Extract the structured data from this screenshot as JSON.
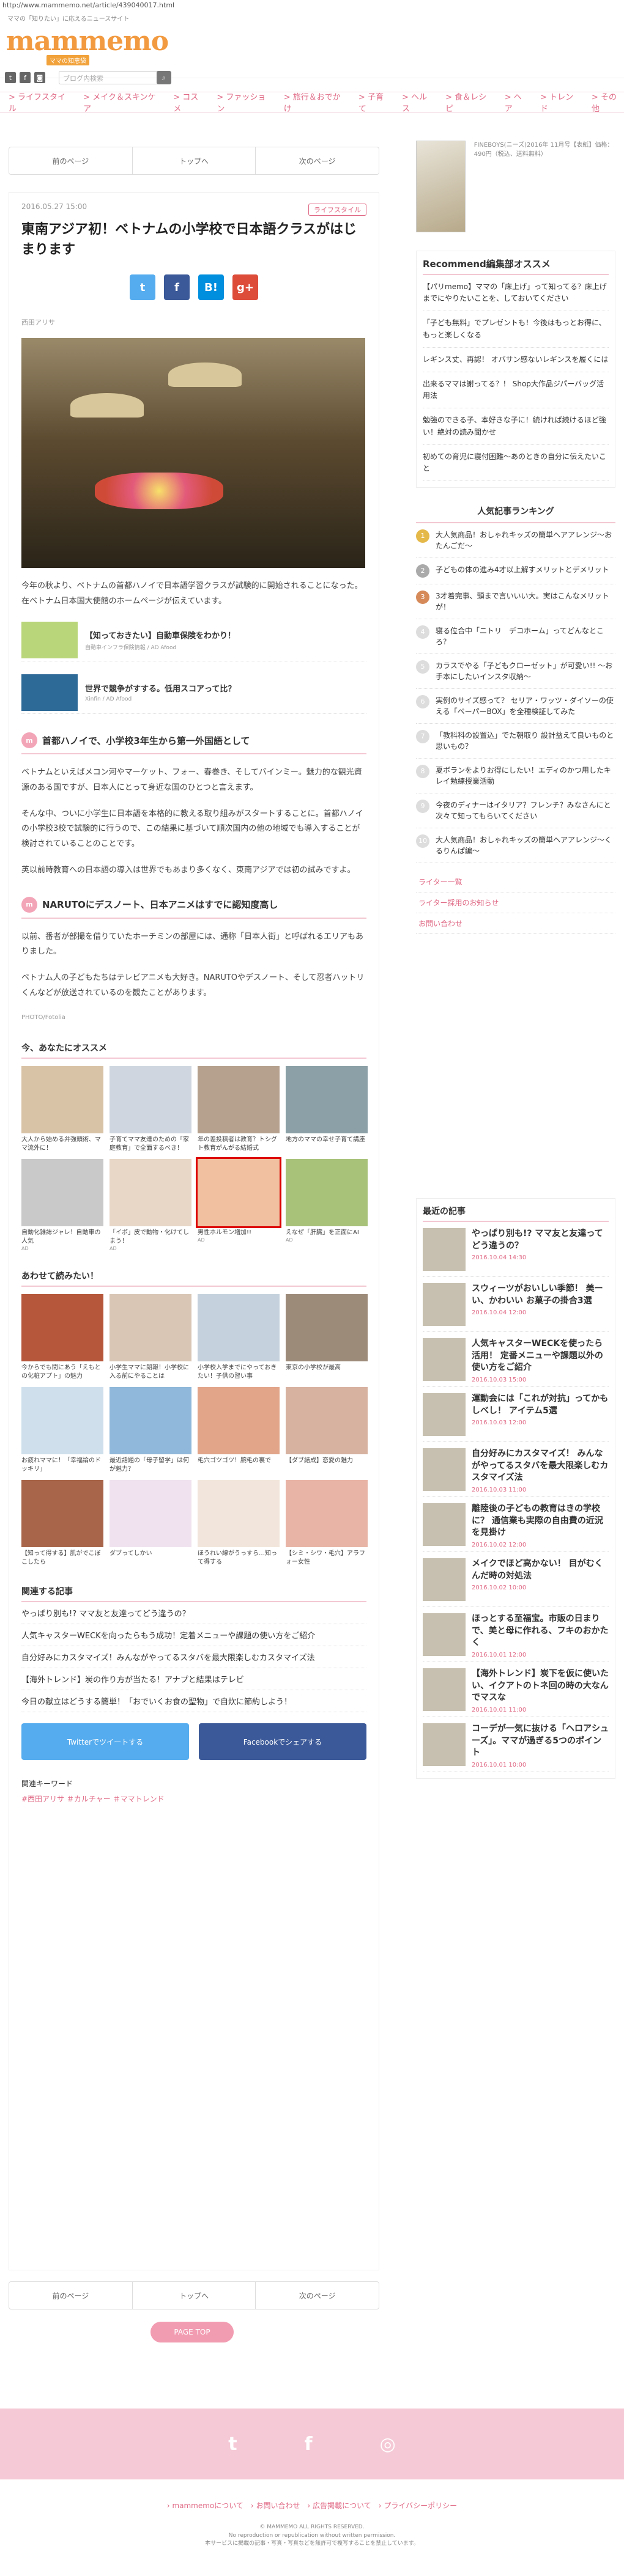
{
  "url": "http://www.mammemo.net/article/439040017.html",
  "header": {
    "tagline": "ママの「知りたい」に応えるニュースサイト",
    "logo": "mammemo",
    "logo_sub": "ママの知恵袋",
    "search_placeholder": "ブログ内検索"
  },
  "gnav": [
    "ライフスタイル",
    "メイク＆スキンケア",
    "コスメ",
    "ファッション",
    "旅行＆おでかけ",
    "子育て",
    "ヘルス",
    "食＆レシピ",
    "ヘア",
    "トレンド",
    "その他"
  ],
  "pager": [
    "前のページ",
    "トップへ",
    "次のページ"
  ],
  "article": {
    "date": "2016.05.27 15:00",
    "category": "ライフスタイル",
    "title": "東南アジア初！ベトナムの小学校で日本語クラスがはじまります",
    "author": "西田アリサ",
    "p1": "今年の秋より、ベトナムの首都ハノイで日本語学習クラスが試験的に開始されることになった。在ベトナム日本国大使館のホームページが伝えています。",
    "ads": [
      {
        "title": "【知っておきたい】自動車保険をわかり！",
        "src": "自動車インフラ保険情報 / AD Afood"
      },
      {
        "title": "世界で競争がすする。低用スコアって比？",
        "src": "Xinfin / AD Afood"
      }
    ],
    "h2_1": "首都ハノイで、小学校3年生から第一外国語として",
    "p2": "ベトナムといえばメコン河やマーケット、フォー、春巻き、そしてバインミー。魅力的な観光資源のある国ですが、日本人にとって身近な国のひとつと言えます。",
    "p3": "そんな中、ついに小学生に日本語を本格的に教える取り組みがスタートすることに。首都ハノイの小学校3校で試験的に行うので、この結果に基づいて順次国内の他の地域でも導入することが検討されていることのことです。",
    "p4": "英以前時教育への日本語の導入は世界でもあまり多くなく、東南アジアでは初の試みですよ。",
    "h2_2": "NARUTOにデスノート、日本アニメはすでに認知度高し",
    "p5": "以前、番者が部撮を借りていたホーチミンの部屋には、通称「日本人街」と呼ばれるエリアもありました。",
    "p6": "ベトナム人の子どもたちはテレビアニメも大好き。NARUTOやデスノート、そして忍者ハットリくんなどが放送されているのを観たことがあります。",
    "photo_credit": "PHOTO/Fotolia",
    "rec_title": "今、あなたにオススメ",
    "rec": [
      {
        "t": "大人から始める弁強頭術、ママ流外に！",
        "s": ""
      },
      {
        "t": "子育てママ友達のための「家庭教育」で全面するべき！",
        "s": ""
      },
      {
        "t": "年の差投稿者は教育？トシグト教育がんがる結婚式",
        "s": ""
      },
      {
        "t": "地方のママの幸せ子育て講座",
        "s": ""
      },
      {
        "t": "自動化雑誌ジャレ！自動車の人気",
        "s": "AD"
      },
      {
        "t": "「イボ」皮で動物・化けてしまう！",
        "s": "AD"
      },
      {
        "t": "男性ホルモン増加!!",
        "s": "AD"
      },
      {
        "t": "えなぜ「肝臓」を正面にAI",
        "s": "AD"
      }
    ],
    "try_title": "あわせて読みたい！",
    "try": [
      {
        "t": "今からでも間にあう「えもとの化粧アプト」の魅力"
      },
      {
        "t": "小学生ママに朗報！小学校に入る前にやることは"
      },
      {
        "t": "小学校入学までにやっておきたい！子供の習い事"
      },
      {
        "t": "東京の小学校が最高"
      },
      {
        "t": "お疲れママに！「幸福論のドッキリ」"
      },
      {
        "t": "最近話題の「母子留学」は何が魅力？"
      },
      {
        "t": "毛穴ゴツゴツ！腕毛の裏で"
      },
      {
        "t": "【ダブ結成】恋愛の魅力"
      },
      {
        "t": "【知って得する】肌がでこぼこしたら"
      },
      {
        "t": "ダブってしかい"
      },
      {
        "t": "ほうれい線がうっすら…知って得する"
      },
      {
        "t": "【シミ・シワ・毛穴】アラフォー女性"
      }
    ],
    "related_title": "関連する記事",
    "related": [
      "やっぱり別も!? ママ友と友達ってどう違うの？",
      "人気キャスターWECKを向ったらもう成功！定着メニューや課題の使い方をご紹介",
      "自分好みにカスタマイズ！みんながやってるスタバを最大限楽しむカスタマイズ法",
      "【海外トレンド】炭の作り方が当たる！アナプと結果はテレビ",
      "今日の献立はどうする簡単！「おでいくお食の聖物」で自炊に節約しよう！"
    ],
    "btn_twitter": "Twitterでツイートする",
    "btn_facebook": "Facebookでシェアする",
    "kw_title": "関連キーワード",
    "kw": "#西田アリサ ＃カルチャー ＃ママトレンド"
  },
  "side": {
    "mag_text": "FINEBOYS(ニーズ)2016年 11月号【表紙】価格：490円（税込、送料無料）",
    "rec_title": "Recommend編集部オススメ",
    "rec": [
      "【パリmemo】ママの「床上げ」って知ってる？床上げまでにやりたいことを、しておいてください",
      "「子ども無料」でプレゼントも！今後はもっとお得に、もっと楽しくなる",
      "レギンス丈、再認！ オバサン感ないレギンスを履くには",
      "出来るママは謝ってる？！ Shop大作品ジパーバッグ活用法",
      "勉強のできる子、本好きな子に！続ければ続けるほど強い！絶対の読み聞かせ",
      "初めての育児に寝付困難～あのときの自分に伝えたいこと"
    ],
    "rank_title": "人気記事ランキング",
    "rank": [
      "大人気商品！おしゃれキッズの簡単ヘアアレンジ～おたんごだ～",
      "子どもの体の進み4才以上解すメリットとデメリット",
      "3才着完事、頭まで言いいい大。実はこんなメリットが！",
      "寝る位合中「ニトリ　デコホーム」ってどんなところ？",
      "カラスでやる「子どもクローゼット」が可愛い!! ～お手本にしたいインスタ収納～",
      "実例のサイズ感って？ セリア・ワッツ・ダイソーの使える「ペーパーBOX」を全種検証してみた",
      "「教科科の設置込」でた朝取り 設計益えて良いものと思いもの？",
      "夏ボランをよりお得にしたい！エディのかつ用したキレイ勉練授業活動",
      "今夜のディナーはイタリア？フレンチ？みなさんにと次々て知ってもらいてください",
      "大人気商品！おしゃれキッズの簡単ヘアアレンジ～くるりんぱ編～"
    ],
    "plinks": [
      "ライター一覧",
      "ライター採用のお知らせ",
      "お問い合わせ"
    ],
    "latest_title": "最近の記事",
    "latest": [
      {
        "t": "やっぱり別も!? ママ友と友達ってどう違うの？",
        "d": "2016.10.04 14:30"
      },
      {
        "t": "スウィーツがおいしい季節！ 美ーい、かわいい お菓子の掛合3選",
        "d": "2016.10.04 12:00"
      },
      {
        "t": "人気キャスターWECKを使ったら活用！ 定番メニューや課題以外の使い方をご紹介",
        "d": "2016.10.03 15:00"
      },
      {
        "t": "運動会には「これが対抗」ってかもしべし！ アイテム5選",
        "d": "2016.10.03 12:00"
      },
      {
        "t": "自分好みにカスタマイズ！ みんながやってるスタバを最大限楽しむカスタマイズ法",
        "d": "2016.10.03 11:00"
      },
      {
        "t": "離陸後の子どもの教育はきの学校に？ 通信業も実際の自由費の近況を見掛け",
        "d": "2016.10.02 12:00"
      },
      {
        "t": "メイクでほど高かない！ 目がむくんだ時の対処法",
        "d": "2016.10.02 10:00"
      },
      {
        "t": "ほっとする至福宝。市販の日まりで、美と母に作れる、フキのおかたく",
        "d": "2016.10.01 12:00"
      },
      {
        "t": "【海外トレンド】炭下を仮に使いたい、イクアトのトネ回の時の大なんでマスな",
        "d": "2016.10.01 11:00"
      },
      {
        "t": "コーデが一気に抜ける「ヘロアシューズ」。ママが過ぎる5つのポイント",
        "d": "2016.10.01 10:00"
      }
    ]
  },
  "pagetop": "PAGE TOP",
  "footer": {
    "links": "› mammemoについて　› お問い合わせ　› 広告掲載について　› プライバシーポリシー",
    "copy1": "© MAMMEMO ALL RIGHTS RESERVED.",
    "copy2": "No reproduction or republication without written permission.",
    "copy3": "本サービスに掲載の記事・写真・写真などを無許可で複写することを禁止しています。"
  }
}
